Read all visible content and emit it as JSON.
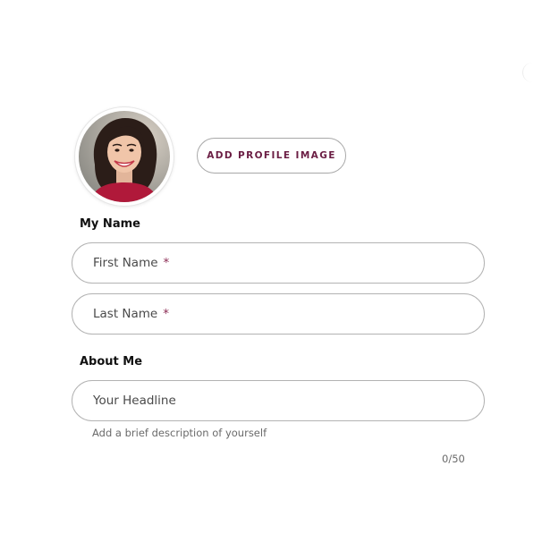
{
  "profile": {
    "avatar_icon": "profile-photo",
    "add_image_label": "ADD PROFILE IMAGE"
  },
  "my_name": {
    "heading": "My Name",
    "first_name_placeholder": "First Name",
    "last_name_placeholder": "Last Name",
    "required_mark": "*"
  },
  "about_me": {
    "heading": "About Me",
    "headline_placeholder": "Your Headline",
    "helper": "Add a brief description of yourself",
    "char_count": "0/50"
  },
  "colors": {
    "accent": "#6b1e44",
    "required": "#8c2d55",
    "field_border": "#b3b3b3"
  }
}
